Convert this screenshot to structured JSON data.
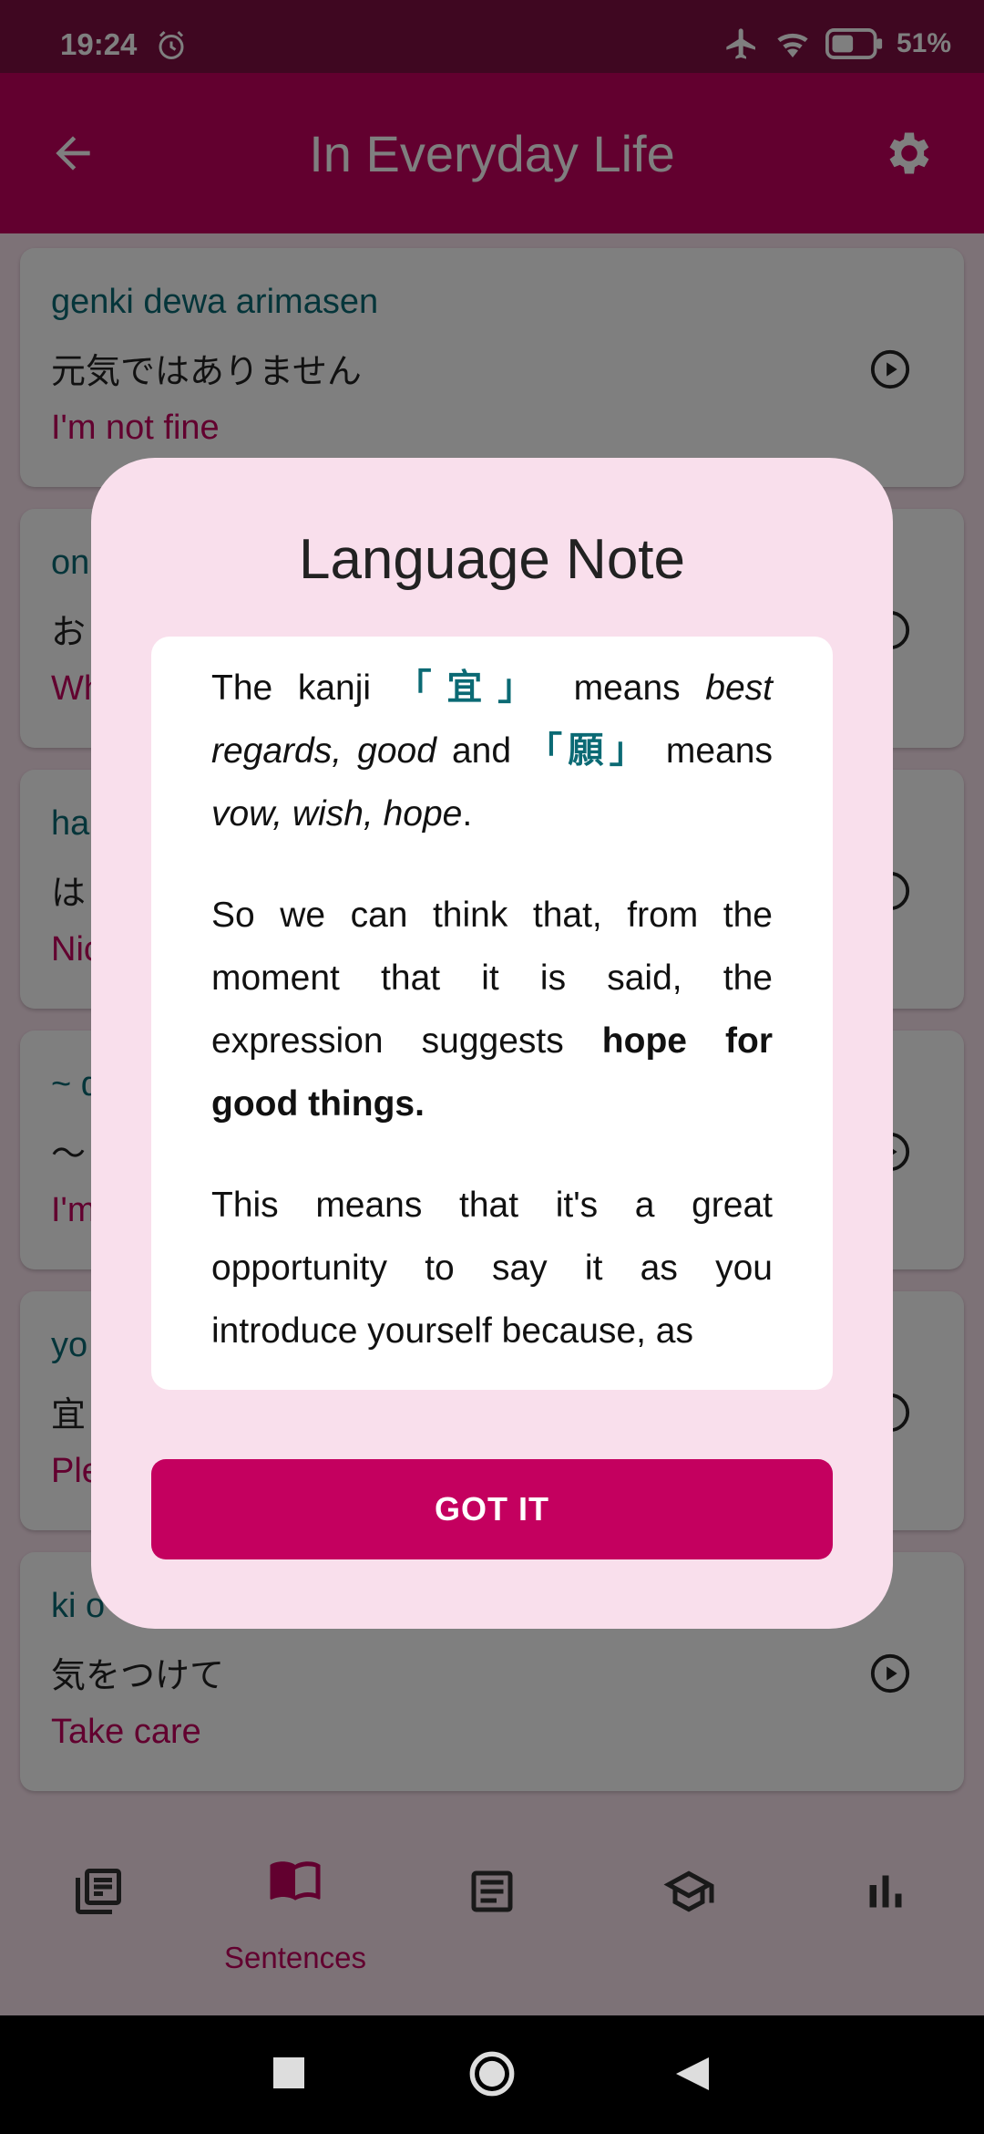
{
  "status_bar": {
    "time": "19:24",
    "battery": "51%"
  },
  "app_bar": {
    "title": "In Everyday Life"
  },
  "cards": [
    {
      "romaji": "genki dewa arimasen",
      "kana": "元気ではありません",
      "meaning": "I'm not fine",
      "action_icon": "play-icon"
    },
    {
      "romaji": "on",
      "kana": "お",
      "meaning": "Wh",
      "action_icon": "info-icon"
    },
    {
      "romaji": "ha",
      "kana": "は",
      "meaning": "Nic",
      "action_icon": "info-icon"
    },
    {
      "romaji": "~ d",
      "kana": "〜",
      "meaning": "I'm",
      "action_icon": "play-icon"
    },
    {
      "romaji": "yo",
      "kana": "宜",
      "meaning": "Ple",
      "action_icon": "info-icon"
    },
    {
      "romaji": "ki o t",
      "kana": "気をつけて",
      "meaning": "Take care",
      "action_icon": "play-icon"
    }
  ],
  "bottom_nav": {
    "items": [
      {
        "icon": "library-icon",
        "label": ""
      },
      {
        "icon": "book-icon",
        "label": "Sentences"
      },
      {
        "icon": "article-icon",
        "label": ""
      },
      {
        "icon": "school-icon",
        "label": ""
      },
      {
        "icon": "chart-icon",
        "label": ""
      }
    ]
  },
  "dialog": {
    "title": "Language Note",
    "p1": {
      "t1": "The kanji ",
      "k1": "「宜」",
      "t2": " means ",
      "i1": "best regards, good",
      "t3": " and ",
      "k2": "「願」",
      "t4": " means ",
      "i2": "vow, wish, hope",
      "t5": "."
    },
    "p2": {
      "t1": "So we can think that, from the moment that it is said, the expression suggests ",
      "b1": "hope for good things."
    },
    "p3": {
      "t1": "This means that it's a great opportunity to say it as you introduce yourself because, as"
    },
    "button": "GOT IT"
  },
  "colors": {
    "primary": "#c4005f",
    "status_bar": "#7e0f43",
    "teal": "#0b6a74",
    "surface": "#fbe4ef"
  }
}
